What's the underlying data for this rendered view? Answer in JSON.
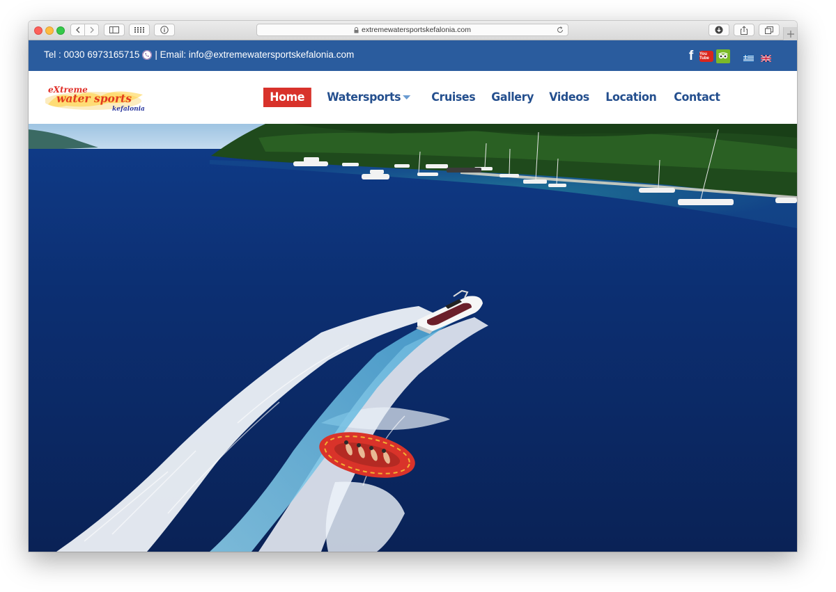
{
  "browser": {
    "url": "extremewatersportskefalonia.com"
  },
  "topbar": {
    "tel_text": "Tel : 0030 6973165715",
    "email_text": "| Email: info@extremewatersportskefalonia.com",
    "youtube_label": "You Tube"
  },
  "logo": {
    "line1": "eXtreme",
    "line2": "water sports",
    "line3": "kefalonia"
  },
  "nav": {
    "items": [
      {
        "label": "Home",
        "active": true
      },
      {
        "label": "Watersports",
        "dropdown": true
      },
      {
        "label": "Cruises"
      },
      {
        "label": "Gallery"
      },
      {
        "label": "Videos"
      },
      {
        "label": "Location"
      },
      {
        "label": "Contact"
      }
    ]
  },
  "colors": {
    "topbar": "#2a5c9e",
    "nav_text": "#244f8e",
    "active_bg": "#d8322b",
    "sea": "#0d2b6b"
  }
}
